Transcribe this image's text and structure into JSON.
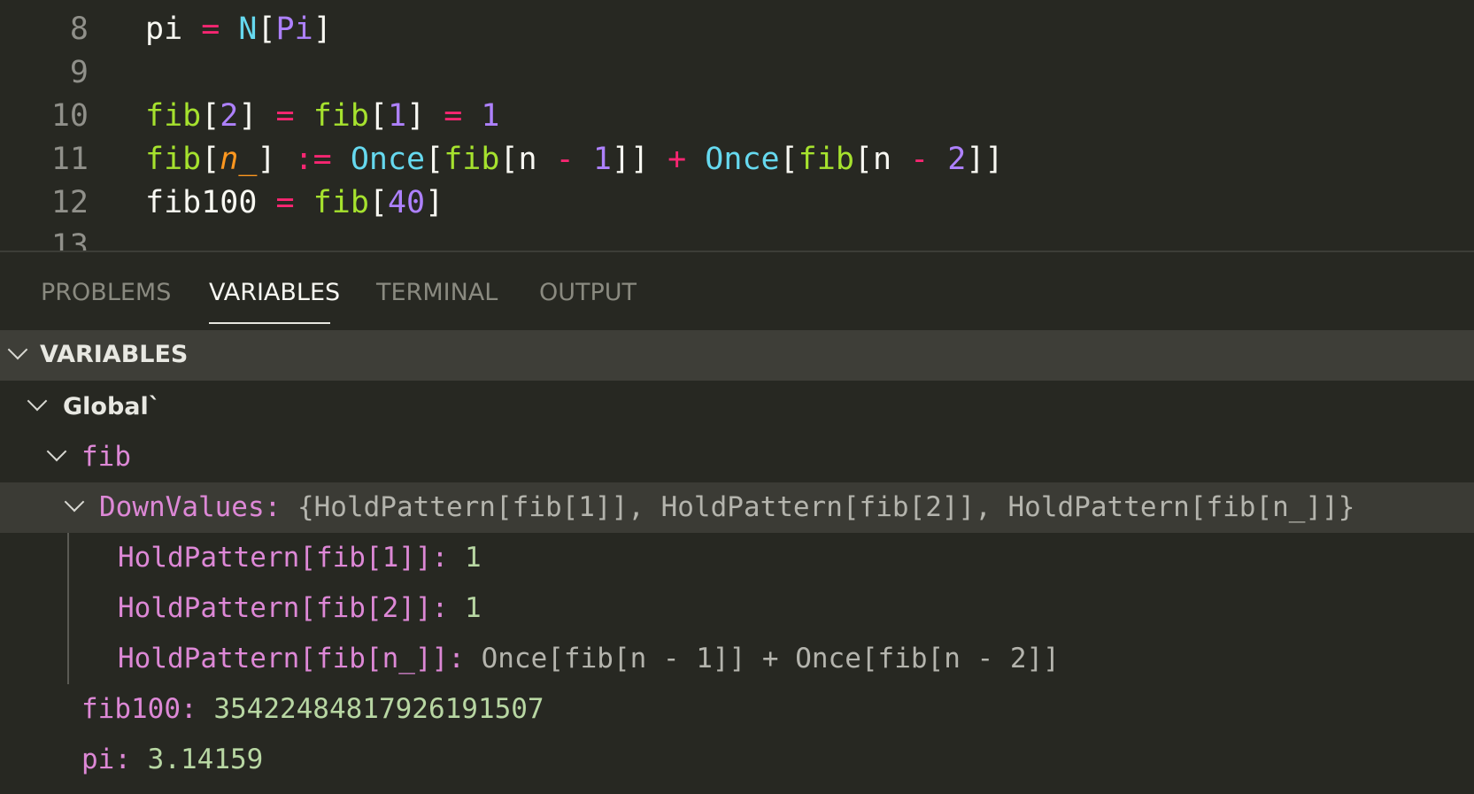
{
  "editor": {
    "lines": [
      {
        "number": "8",
        "tokens": [
          [
            "pi",
            "var"
          ],
          [
            " ",
            "var"
          ],
          [
            "=",
            "op"
          ],
          [
            " ",
            "var"
          ],
          [
            "N",
            "sym"
          ],
          [
            "[",
            "br"
          ],
          [
            "Pi",
            "num"
          ],
          [
            "]",
            "br"
          ]
        ]
      },
      {
        "number": "9",
        "tokens": []
      },
      {
        "number": "10",
        "tokens": [
          [
            "fib",
            "fn"
          ],
          [
            "[",
            "br"
          ],
          [
            "2",
            "num"
          ],
          [
            "]",
            "br"
          ],
          [
            " ",
            "var"
          ],
          [
            "=",
            "op"
          ],
          [
            " ",
            "var"
          ],
          [
            "fib",
            "fn"
          ],
          [
            "[",
            "br"
          ],
          [
            "1",
            "num"
          ],
          [
            "]",
            "br"
          ],
          [
            " ",
            "var"
          ],
          [
            "=",
            "op"
          ],
          [
            " ",
            "var"
          ],
          [
            "1",
            "num"
          ]
        ]
      },
      {
        "number": "11",
        "tokens": [
          [
            "fib",
            "fn"
          ],
          [
            "[",
            "br"
          ],
          [
            "n_",
            "pat"
          ],
          [
            "]",
            "br"
          ],
          [
            " ",
            "var"
          ],
          [
            ":=",
            "op"
          ],
          [
            " ",
            "var"
          ],
          [
            "Once",
            "sym"
          ],
          [
            "[",
            "br"
          ],
          [
            "fib",
            "fn"
          ],
          [
            "[",
            "br"
          ],
          [
            "n",
            "var"
          ],
          [
            " ",
            "var"
          ],
          [
            "-",
            "op"
          ],
          [
            " ",
            "var"
          ],
          [
            "1",
            "num"
          ],
          [
            "]]",
            "br"
          ],
          [
            " ",
            "var"
          ],
          [
            "+",
            "op"
          ],
          [
            " ",
            "var"
          ],
          [
            "Once",
            "sym"
          ],
          [
            "[",
            "br"
          ],
          [
            "fib",
            "fn"
          ],
          [
            "[",
            "br"
          ],
          [
            "n",
            "var"
          ],
          [
            " ",
            "var"
          ],
          [
            "-",
            "op"
          ],
          [
            " ",
            "var"
          ],
          [
            "2",
            "num"
          ],
          [
            "]]",
            "br"
          ]
        ]
      },
      {
        "number": "12",
        "tokens": [
          [
            "fib100",
            "var"
          ],
          [
            " ",
            "var"
          ],
          [
            "=",
            "op"
          ],
          [
            " ",
            "var"
          ],
          [
            "fib",
            "fn"
          ],
          [
            "[",
            "br"
          ],
          [
            "40",
            "num"
          ],
          [
            "]",
            "br"
          ]
        ]
      },
      {
        "number": "13",
        "tokens": []
      }
    ]
  },
  "panel": {
    "tabs": [
      {
        "label": "PROBLEMS",
        "active": false
      },
      {
        "label": "VARIABLES",
        "active": true
      },
      {
        "label": "TERMINAL",
        "active": false
      },
      {
        "label": "OUTPUT",
        "active": false
      }
    ],
    "section_title": "VARIABLES",
    "tree": {
      "scope": "Global`",
      "fib": {
        "name": "fib",
        "downvalues_key": "DownValues:",
        "downvalues_value": "{HoldPattern[fib[1]], HoldPattern[fib[2]], HoldPattern[fib[n_]]}",
        "children": [
          {
            "key": "HoldPattern[fib[1]]:",
            "value": "1",
            "numeric": true
          },
          {
            "key": "HoldPattern[fib[2]]:",
            "value": "1",
            "numeric": true
          },
          {
            "key": "HoldPattern[fib[n_]]:",
            "value": "Once[fib[n - 1]] + Once[fib[n - 2]]",
            "numeric": false
          }
        ]
      },
      "fib100": {
        "key": "fib100:",
        "value": "35422484817926191507"
      },
      "pi": {
        "key": "pi:",
        "value": "3.14159"
      }
    }
  },
  "colors": {
    "background": "#272822",
    "keyword": "#f92672",
    "function": "#a6e22e",
    "symbol": "#66d9ef",
    "number": "#ae81ff",
    "pattern": "#fd971f",
    "variable_name": "#dd88d6",
    "variable_number": "#b8d7a3"
  }
}
